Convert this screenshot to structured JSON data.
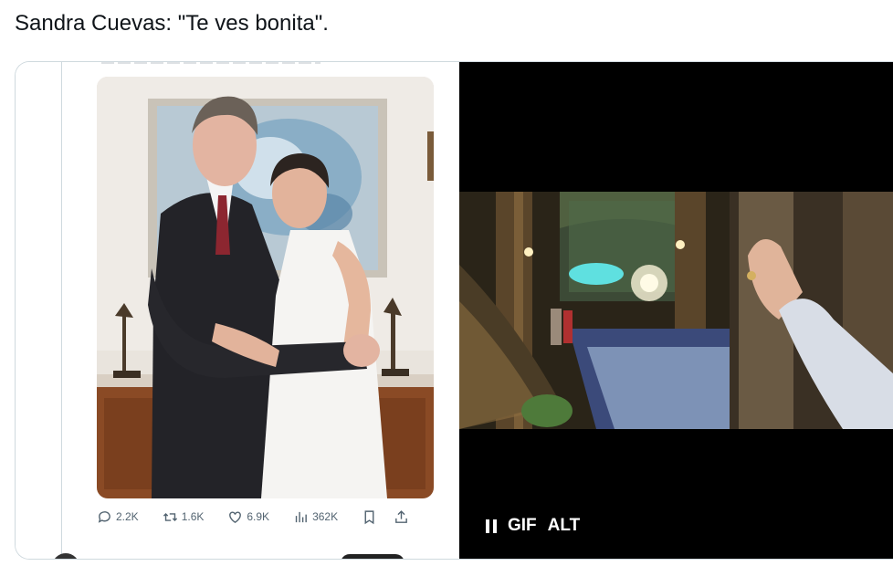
{
  "post": {
    "text": "Sandra Cuevas: \"Te ves bonita\"."
  },
  "embedded_tweet": {
    "metrics": {
      "replies": "2.2K",
      "reposts": "1.6K",
      "likes": "6.9K",
      "views": "362K"
    },
    "icons": [
      "reply-icon",
      "repost-icon",
      "like-icon",
      "views-icon",
      "bookmark-icon",
      "share-icon"
    ]
  },
  "gif": {
    "gif_label": "GIF",
    "alt_label": "ALT"
  },
  "colors": {
    "muted": "#536471",
    "border": "#cfd9de",
    "gif_bg": "#000000"
  }
}
